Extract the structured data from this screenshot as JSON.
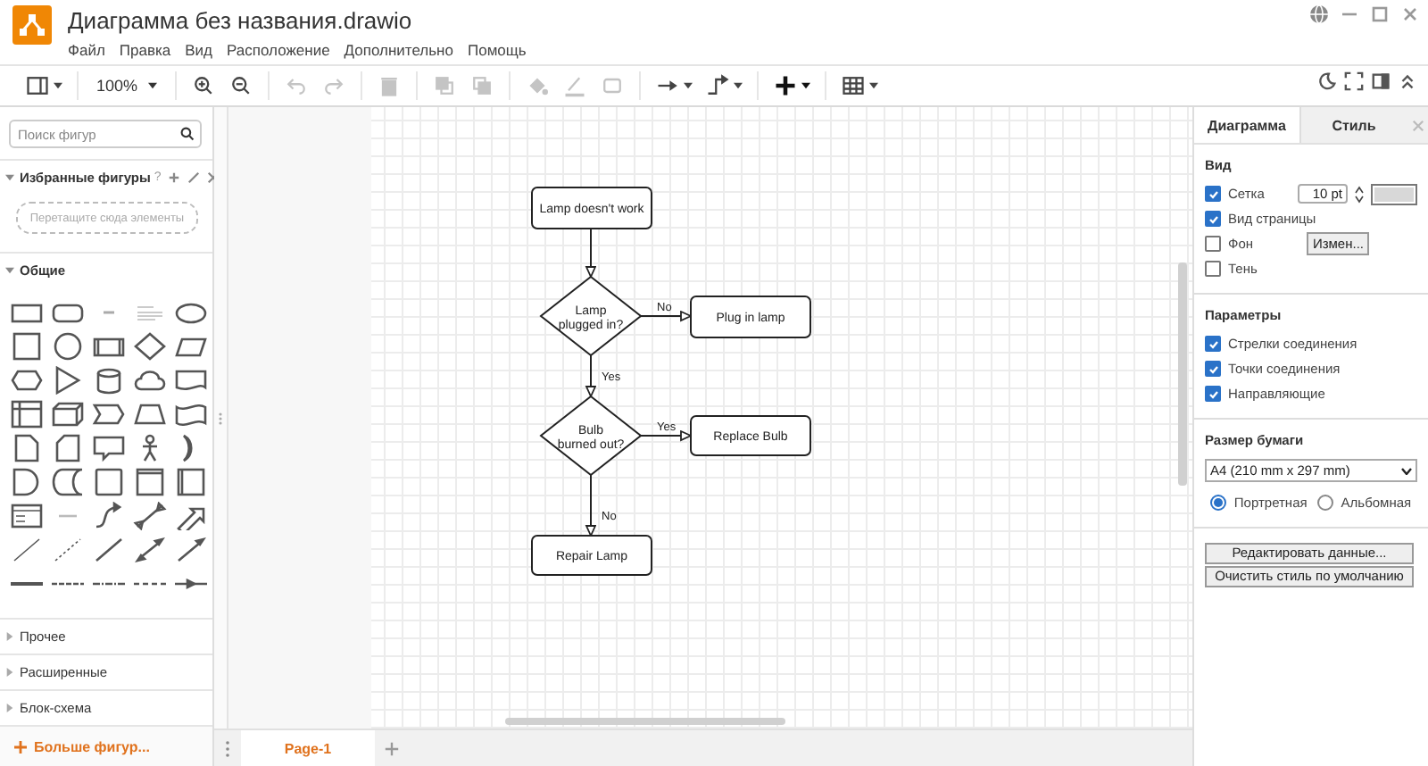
{
  "window": {
    "title": "Диаграмма без названия.drawio"
  },
  "menu": [
    "Файл",
    "Правка",
    "Вид",
    "Расположение",
    "Дополнительно",
    "Помощь"
  ],
  "toolbar": [
    [
      {
        "kind": "panel",
        "dropdown": true,
        "disabled": false
      }
    ],
    [
      {
        "kind": "zoom",
        "label": "100%",
        "dropdown": true,
        "disabled": false
      }
    ],
    [
      {
        "kind": "zoom-in",
        "dropdown": false,
        "disabled": false
      },
      {
        "kind": "zoom-out",
        "dropdown": false,
        "disabled": false
      }
    ],
    [
      {
        "kind": "undo",
        "dropdown": false,
        "disabled": true
      },
      {
        "kind": "redo",
        "dropdown": false,
        "disabled": true
      }
    ],
    [
      {
        "kind": "delete",
        "dropdown": false,
        "disabled": true
      }
    ],
    [
      {
        "kind": "to-front",
        "dropdown": false,
        "disabled": true
      },
      {
        "kind": "to-back",
        "dropdown": false,
        "disabled": true
      }
    ],
    [
      {
        "kind": "fill",
        "dropdown": false,
        "disabled": true
      },
      {
        "kind": "line-color",
        "dropdown": false,
        "disabled": true
      },
      {
        "kind": "shadow",
        "dropdown": false,
        "disabled": true
      }
    ],
    [
      {
        "kind": "connection",
        "dropdown": true,
        "disabled": false
      },
      {
        "kind": "waypoints",
        "dropdown": true,
        "disabled": false
      }
    ],
    [
      {
        "kind": "insert",
        "dropdown": true,
        "disabled": false
      }
    ],
    [
      {
        "kind": "table",
        "dropdown": true,
        "disabled": false
      }
    ]
  ],
  "sidebar": {
    "search": {
      "placeholder": "Поиск фигур"
    },
    "sections": [
      {
        "title": "Избранные фигуры",
        "expanded": true,
        "help": "?",
        "drop_hint": "Перетащите сюда элементы"
      },
      {
        "title": "Общие",
        "expanded": true
      },
      {
        "title": "Прочее",
        "expanded": false
      },
      {
        "title": "Расширенные",
        "expanded": false
      },
      {
        "title": "Блок-схема",
        "expanded": false
      }
    ],
    "more": "Больше фигур..."
  },
  "diagram": {
    "nodes": [
      {
        "kind": "process",
        "label": "Lamp doesn't work"
      },
      {
        "kind": "decision",
        "label": "Lamp plugged in?"
      },
      {
        "kind": "process",
        "label": "Plug in lamp"
      },
      {
        "kind": "decision",
        "label": "Bulb burned out?"
      },
      {
        "kind": "process",
        "label": "Replace Bulb"
      },
      {
        "kind": "process",
        "label": "Repair Lamp"
      }
    ],
    "edge_labels": [
      "No",
      "Yes",
      "Yes",
      "No"
    ]
  },
  "pages": [
    {
      "label": "Page-1",
      "selected": true
    }
  ],
  "format_panel": {
    "tabs": [
      {
        "label": "Диаграмма",
        "selected": true
      },
      {
        "label": "Стиль",
        "selected": false
      }
    ],
    "sections": [
      {
        "title": "Вид",
        "options": [
          {
            "kind": "checkbox",
            "label": "Сетка",
            "checked": true,
            "field": "10 pt"
          },
          {
            "kind": "checkbox",
            "label": "Вид страницы",
            "checked": true
          },
          {
            "kind": "checkbox",
            "label": "Фон",
            "checked": false,
            "button": "Измен..."
          },
          {
            "kind": "checkbox",
            "label": "Тень",
            "checked": false
          }
        ]
      },
      {
        "title": "Параметры",
        "options": [
          {
            "kind": "checkbox",
            "label": "Стрелки соединения",
            "checked": true
          },
          {
            "kind": "checkbox",
            "label": "Точки соединения",
            "checked": true
          },
          {
            "kind": "checkbox",
            "label": "Направляющие",
            "checked": true
          }
        ]
      },
      {
        "title": "Размер бумаги",
        "select": "A4 (210 mm x 297 mm)",
        "options": [
          {
            "kind": "radio",
            "label": "Портретная",
            "selected": true
          },
          {
            "kind": "radio",
            "label": "Альбомная",
            "selected": false
          }
        ]
      }
    ],
    "buttons": [
      "Редактировать данные...",
      "Очистить стиль по умолчанию"
    ]
  }
}
